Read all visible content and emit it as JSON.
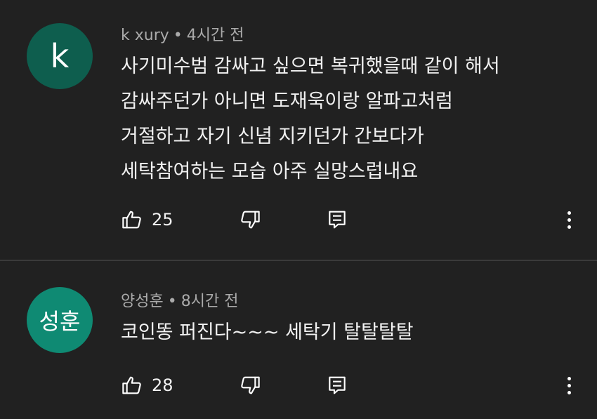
{
  "comments": [
    {
      "avatar_text": "k",
      "avatar_color": "#0e5e4e",
      "author": "k xury",
      "separator": "•",
      "time": "4시간 전",
      "lines": [
        "사기미수범 감싸고 싶으면 복귀했을때 같이 해서",
        "감싸주던가 아니면 도재욱이랑 알파고처럼",
        "거절하고 자기 신념 지키던가 간보다가",
        "세탁참여하는 모습 아주 실망스럽내요"
      ],
      "likes": "25",
      "icons": {
        "like": "thumbs-up-icon",
        "dislike": "thumbs-down-icon",
        "reply": "reply-icon",
        "more": "more-vert-icon"
      }
    },
    {
      "avatar_text": "성훈",
      "avatar_color": "#0f8a73",
      "author": "양성훈",
      "separator": "•",
      "time": "8시간 전",
      "lines": [
        "코인똥 퍼진다~~~ 세탁기 탈탈탈탈"
      ],
      "likes": "28",
      "icons": {
        "like": "thumbs-up-icon",
        "dislike": "thumbs-down-icon",
        "reply": "reply-icon",
        "more": "more-vert-icon"
      }
    }
  ],
  "colors": {
    "background": "#212121",
    "meta_text": "#aaaaaa",
    "body_text": "#f1f1f1"
  }
}
